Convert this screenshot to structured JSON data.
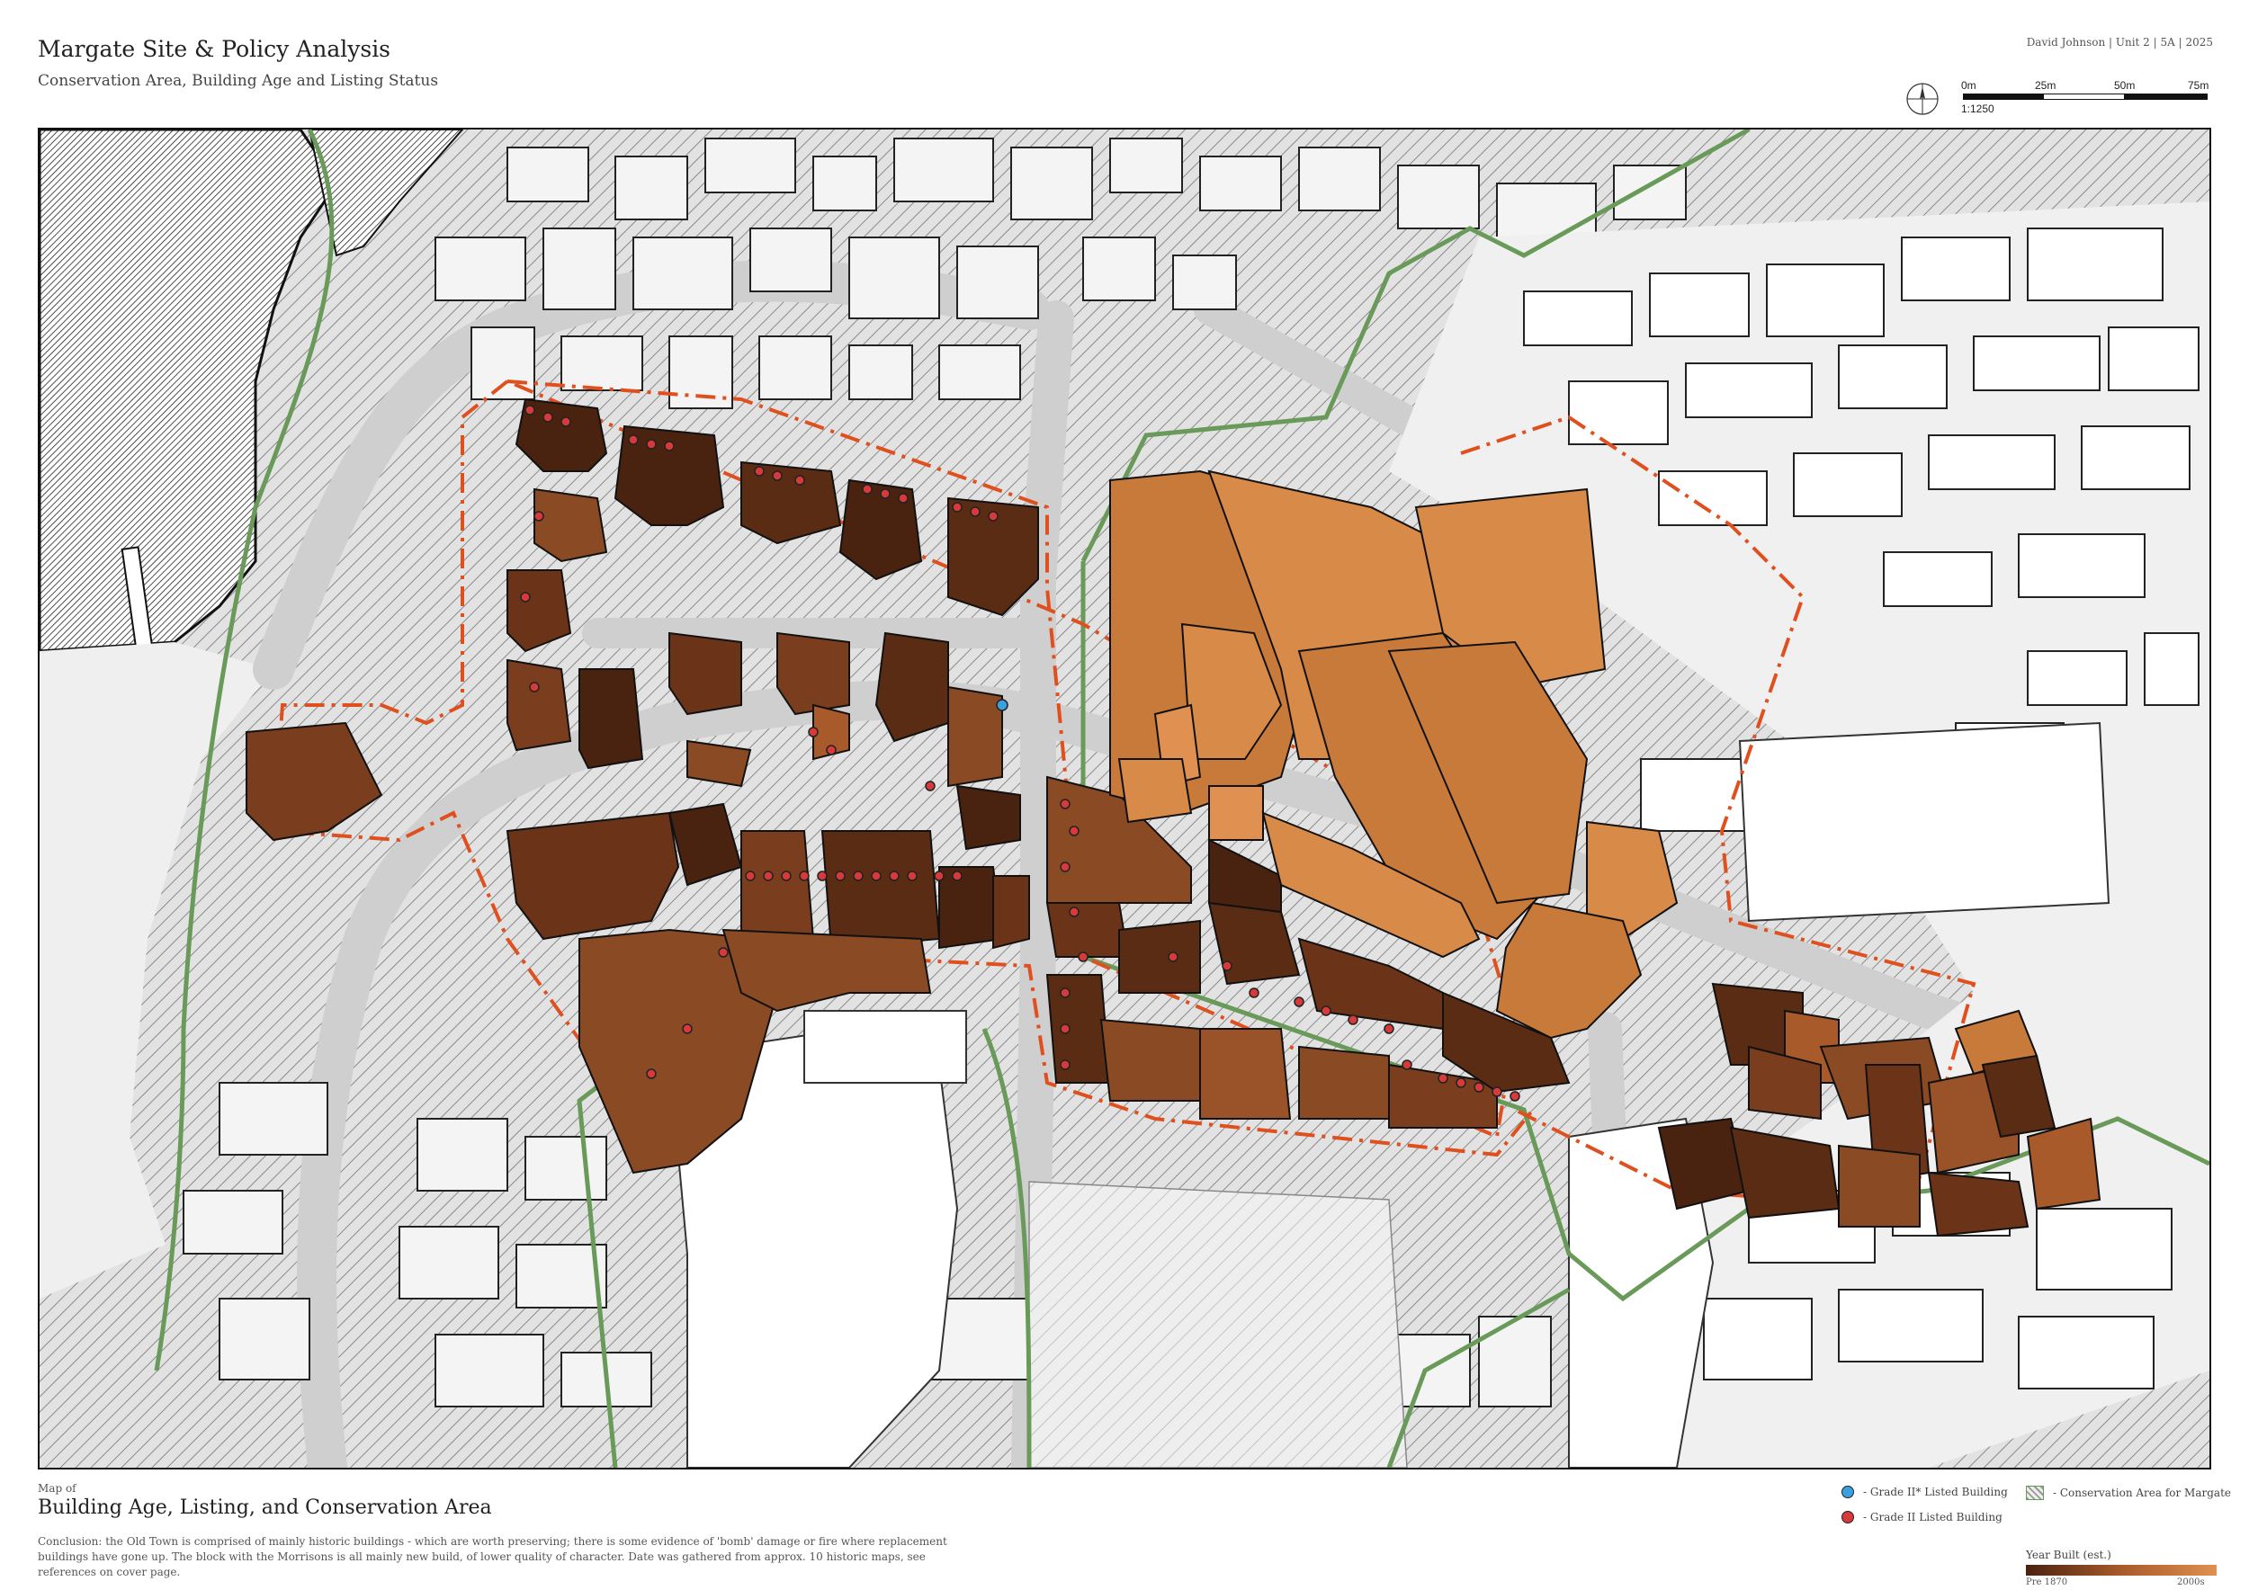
{
  "header": {
    "title": "Margate Site & Policy Analysis",
    "subtitle": "Conservation Area, Building Age and Listing Status",
    "author_line": "David Johnson  |  Unit 2  |  5A  |  2025"
  },
  "scale": {
    "ticks": [
      "0m",
      "25m",
      "50m",
      "75m"
    ],
    "ratio": "1:1250"
  },
  "footer": {
    "map_of": "Map of",
    "heading": "Building Age, Listing, and Conservation Area",
    "conclusion": "Conclusion: the Old Town is comprised of mainly historic buildings - which are worth preserving; there is some evidence of 'bomb' damage or fire where replacement buildings have gone up. The block with the Morrisons is all mainly new build, of lower quality of character. Date was gathered from approx. 10 historic maps, see references on cover page."
  },
  "legend": {
    "grade_2_star": "- Grade II* Listed Building",
    "grade_2": "- Grade II Listed Building",
    "conservation": "- Conservation Area for Margate",
    "year_built_label": "Year Built (est.)",
    "year_min": "Pre 1870",
    "year_max": "2000s",
    "colors": {
      "grade_2_star": "#3aa0e0",
      "grade_2": "#d63a3a",
      "conservation": "#6a9a5a",
      "site_boundary": "#e0501e",
      "oldest": "#4a2210",
      "newest": "#e09050"
    }
  }
}
